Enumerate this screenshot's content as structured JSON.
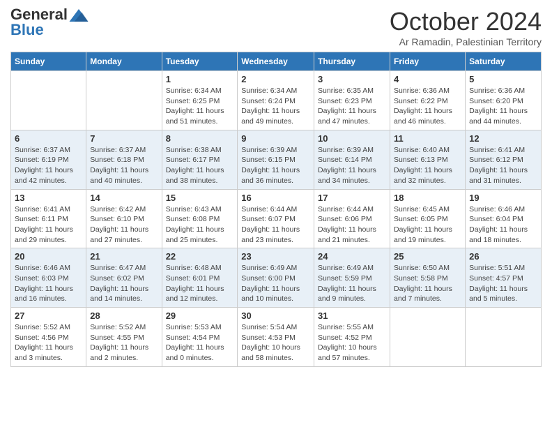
{
  "header": {
    "logo_general": "General",
    "logo_blue": "Blue",
    "month_title": "October 2024",
    "subtitle": "Ar Ramadin, Palestinian Territory"
  },
  "weekdays": [
    "Sunday",
    "Monday",
    "Tuesday",
    "Wednesday",
    "Thursday",
    "Friday",
    "Saturday"
  ],
  "weeks": [
    [
      {
        "day": "",
        "sunrise": "",
        "sunset": "",
        "daylight": ""
      },
      {
        "day": "",
        "sunrise": "",
        "sunset": "",
        "daylight": ""
      },
      {
        "day": "1",
        "sunrise": "Sunrise: 6:34 AM",
        "sunset": "Sunset: 6:25 PM",
        "daylight": "Daylight: 11 hours and 51 minutes."
      },
      {
        "day": "2",
        "sunrise": "Sunrise: 6:34 AM",
        "sunset": "Sunset: 6:24 PM",
        "daylight": "Daylight: 11 hours and 49 minutes."
      },
      {
        "day": "3",
        "sunrise": "Sunrise: 6:35 AM",
        "sunset": "Sunset: 6:23 PM",
        "daylight": "Daylight: 11 hours and 47 minutes."
      },
      {
        "day": "4",
        "sunrise": "Sunrise: 6:36 AM",
        "sunset": "Sunset: 6:22 PM",
        "daylight": "Daylight: 11 hours and 46 minutes."
      },
      {
        "day": "5",
        "sunrise": "Sunrise: 6:36 AM",
        "sunset": "Sunset: 6:20 PM",
        "daylight": "Daylight: 11 hours and 44 minutes."
      }
    ],
    [
      {
        "day": "6",
        "sunrise": "Sunrise: 6:37 AM",
        "sunset": "Sunset: 6:19 PM",
        "daylight": "Daylight: 11 hours and 42 minutes."
      },
      {
        "day": "7",
        "sunrise": "Sunrise: 6:37 AM",
        "sunset": "Sunset: 6:18 PM",
        "daylight": "Daylight: 11 hours and 40 minutes."
      },
      {
        "day": "8",
        "sunrise": "Sunrise: 6:38 AM",
        "sunset": "Sunset: 6:17 PM",
        "daylight": "Daylight: 11 hours and 38 minutes."
      },
      {
        "day": "9",
        "sunrise": "Sunrise: 6:39 AM",
        "sunset": "Sunset: 6:15 PM",
        "daylight": "Daylight: 11 hours and 36 minutes."
      },
      {
        "day": "10",
        "sunrise": "Sunrise: 6:39 AM",
        "sunset": "Sunset: 6:14 PM",
        "daylight": "Daylight: 11 hours and 34 minutes."
      },
      {
        "day": "11",
        "sunrise": "Sunrise: 6:40 AM",
        "sunset": "Sunset: 6:13 PM",
        "daylight": "Daylight: 11 hours and 32 minutes."
      },
      {
        "day": "12",
        "sunrise": "Sunrise: 6:41 AM",
        "sunset": "Sunset: 6:12 PM",
        "daylight": "Daylight: 11 hours and 31 minutes."
      }
    ],
    [
      {
        "day": "13",
        "sunrise": "Sunrise: 6:41 AM",
        "sunset": "Sunset: 6:11 PM",
        "daylight": "Daylight: 11 hours and 29 minutes."
      },
      {
        "day": "14",
        "sunrise": "Sunrise: 6:42 AM",
        "sunset": "Sunset: 6:10 PM",
        "daylight": "Daylight: 11 hours and 27 minutes."
      },
      {
        "day": "15",
        "sunrise": "Sunrise: 6:43 AM",
        "sunset": "Sunset: 6:08 PM",
        "daylight": "Daylight: 11 hours and 25 minutes."
      },
      {
        "day": "16",
        "sunrise": "Sunrise: 6:44 AM",
        "sunset": "Sunset: 6:07 PM",
        "daylight": "Daylight: 11 hours and 23 minutes."
      },
      {
        "day": "17",
        "sunrise": "Sunrise: 6:44 AM",
        "sunset": "Sunset: 6:06 PM",
        "daylight": "Daylight: 11 hours and 21 minutes."
      },
      {
        "day": "18",
        "sunrise": "Sunrise: 6:45 AM",
        "sunset": "Sunset: 6:05 PM",
        "daylight": "Daylight: 11 hours and 19 minutes."
      },
      {
        "day": "19",
        "sunrise": "Sunrise: 6:46 AM",
        "sunset": "Sunset: 6:04 PM",
        "daylight": "Daylight: 11 hours and 18 minutes."
      }
    ],
    [
      {
        "day": "20",
        "sunrise": "Sunrise: 6:46 AM",
        "sunset": "Sunset: 6:03 PM",
        "daylight": "Daylight: 11 hours and 16 minutes."
      },
      {
        "day": "21",
        "sunrise": "Sunrise: 6:47 AM",
        "sunset": "Sunset: 6:02 PM",
        "daylight": "Daylight: 11 hours and 14 minutes."
      },
      {
        "day": "22",
        "sunrise": "Sunrise: 6:48 AM",
        "sunset": "Sunset: 6:01 PM",
        "daylight": "Daylight: 11 hours and 12 minutes."
      },
      {
        "day": "23",
        "sunrise": "Sunrise: 6:49 AM",
        "sunset": "Sunset: 6:00 PM",
        "daylight": "Daylight: 11 hours and 10 minutes."
      },
      {
        "day": "24",
        "sunrise": "Sunrise: 6:49 AM",
        "sunset": "Sunset: 5:59 PM",
        "daylight": "Daylight: 11 hours and 9 minutes."
      },
      {
        "day": "25",
        "sunrise": "Sunrise: 6:50 AM",
        "sunset": "Sunset: 5:58 PM",
        "daylight": "Daylight: 11 hours and 7 minutes."
      },
      {
        "day": "26",
        "sunrise": "Sunrise: 5:51 AM",
        "sunset": "Sunset: 4:57 PM",
        "daylight": "Daylight: 11 hours and 5 minutes."
      }
    ],
    [
      {
        "day": "27",
        "sunrise": "Sunrise: 5:52 AM",
        "sunset": "Sunset: 4:56 PM",
        "daylight": "Daylight: 11 hours and 3 minutes."
      },
      {
        "day": "28",
        "sunrise": "Sunrise: 5:52 AM",
        "sunset": "Sunset: 4:55 PM",
        "daylight": "Daylight: 11 hours and 2 minutes."
      },
      {
        "day": "29",
        "sunrise": "Sunrise: 5:53 AM",
        "sunset": "Sunset: 4:54 PM",
        "daylight": "Daylight: 11 hours and 0 minutes."
      },
      {
        "day": "30",
        "sunrise": "Sunrise: 5:54 AM",
        "sunset": "Sunset: 4:53 PM",
        "daylight": "Daylight: 10 hours and 58 minutes."
      },
      {
        "day": "31",
        "sunrise": "Sunrise: 5:55 AM",
        "sunset": "Sunset: 4:52 PM",
        "daylight": "Daylight: 10 hours and 57 minutes."
      },
      {
        "day": "",
        "sunrise": "",
        "sunset": "",
        "daylight": ""
      },
      {
        "day": "",
        "sunrise": "",
        "sunset": "",
        "daylight": ""
      }
    ]
  ]
}
